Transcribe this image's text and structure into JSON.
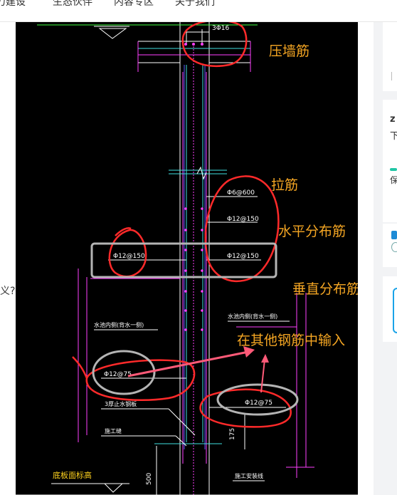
{
  "nav": [
    "力建设",
    "生态伙伴",
    "内容专区",
    "关于我们"
  ],
  "left_text": "义?",
  "right_panel": {
    "glyph1": "z",
    "glyph2": "下",
    "glyph3": "保"
  },
  "annotations": {
    "top_wall": "压墙筋",
    "tie": "拉筋",
    "horizontal": "水平分布筋",
    "vertical": "垂直分布筋",
    "other": "在其他钢筋中输入"
  },
  "drawing": {
    "top_bar": "3Φ16",
    "tie_spec": "Φ6@600",
    "h_spec_right": "Φ12@150",
    "v_spec_left": "Φ12@150",
    "v_spec_right": "Φ12@150",
    "water_left": "水池内侧(背水一侧)",
    "water_right": "水池内侧(背水一侧)",
    "spec_left_low": "Φ12@75",
    "spec_right_low": "Φ12@75",
    "stop_plate": "3厚止水钢板",
    "construction_joint": "施工缝",
    "base_label": "底板面标高",
    "dim_175": "175",
    "dim_500": "500",
    "bottom_right_label": "施工安装线"
  },
  "colors": {
    "annotation": "#f5a623",
    "circle_red": "#ff2a2a",
    "circle_gray": "#b4b4b4",
    "cad_bg": "#000000"
  }
}
